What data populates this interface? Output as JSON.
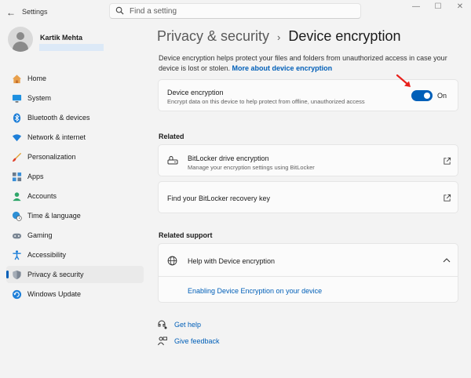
{
  "window": {
    "app_title": "Settings",
    "controls": {
      "minimize": "—",
      "maximize": "☐",
      "close": "✕"
    }
  },
  "search": {
    "placeholder": "Find a setting"
  },
  "user": {
    "name": "Kartik Mehta"
  },
  "sidebar": {
    "items": [
      {
        "label": "Home",
        "icon": "home-icon"
      },
      {
        "label": "System",
        "icon": "system-icon"
      },
      {
        "label": "Bluetooth & devices",
        "icon": "bluetooth-icon"
      },
      {
        "label": "Network & internet",
        "icon": "wifi-icon"
      },
      {
        "label": "Personalization",
        "icon": "brush-icon"
      },
      {
        "label": "Apps",
        "icon": "apps-icon"
      },
      {
        "label": "Accounts",
        "icon": "accounts-icon"
      },
      {
        "label": "Time & language",
        "icon": "globe-clock-icon"
      },
      {
        "label": "Gaming",
        "icon": "gamepad-icon"
      },
      {
        "label": "Accessibility",
        "icon": "accessibility-icon"
      },
      {
        "label": "Privacy & security",
        "icon": "shield-icon",
        "selected": true
      },
      {
        "label": "Windows Update",
        "icon": "update-icon"
      }
    ]
  },
  "breadcrumb": {
    "parent": "Privacy & security",
    "separator": "›",
    "current": "Device encryption"
  },
  "description": {
    "text": "Device encryption helps protect your files and folders from unauthorized access in case your device is lost or stolen. ",
    "link": "More about device encryption"
  },
  "device_encryption": {
    "title": "Device encryption",
    "subtitle": "Encrypt data on this device to help protect from offline, unauthorized access",
    "state": "On",
    "enabled": true
  },
  "related": {
    "heading": "Related",
    "bitlocker": {
      "title": "BitLocker drive encryption",
      "subtitle": "Manage your encryption settings using BitLocker"
    },
    "recovery": {
      "title": "Find your BitLocker recovery key"
    }
  },
  "related_support": {
    "heading": "Related support",
    "help_title": "Help with Device encryption",
    "link": "Enabling Device Encryption on your device"
  },
  "footer": {
    "get_help": "Get help",
    "give_feedback": "Give feedback"
  },
  "colors": {
    "accent": "#005fb8",
    "annotation_arrow": "#e8201b"
  }
}
